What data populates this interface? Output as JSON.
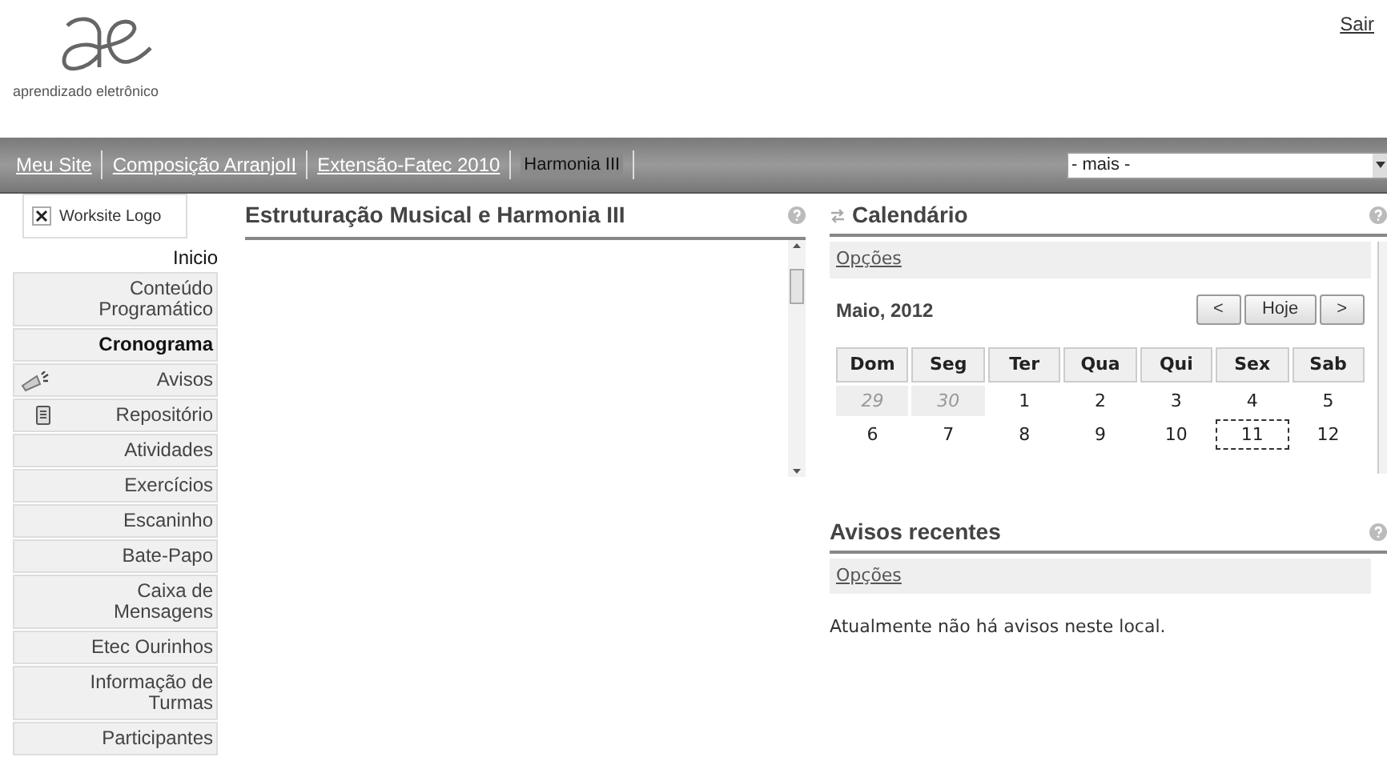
{
  "header": {
    "logo_caption": "aprendizado eletrônico",
    "logout": "Sair"
  },
  "nav": {
    "tabs": [
      {
        "label": "Meu Site",
        "selected": false
      },
      {
        "label": "Composição ArranjoII",
        "selected": false
      },
      {
        "label": "Extensão-Fatec 2010",
        "selected": false
      },
      {
        "label": "Harmonia III",
        "selected": true
      }
    ],
    "more_select": {
      "value": "- mais -"
    }
  },
  "sidebar": {
    "logo_placeholder": "Worksite Logo",
    "items": [
      {
        "label": "Inicio",
        "kind": "heading",
        "selected": false
      },
      {
        "label": "Conteúdo Programático",
        "kind": "plain",
        "selected": false
      },
      {
        "label": "Cronograma",
        "kind": "plain",
        "selected": true
      },
      {
        "label": "Avisos",
        "kind": "announce",
        "selected": false
      },
      {
        "label": "Repositório",
        "kind": "repository",
        "selected": false
      },
      {
        "label": "Atividades",
        "kind": "plain",
        "selected": false
      },
      {
        "label": "Exercícios",
        "kind": "plain",
        "selected": false
      },
      {
        "label": "Escaninho",
        "kind": "plain",
        "selected": false
      },
      {
        "label": "Bate-Papo",
        "kind": "plain",
        "selected": false
      },
      {
        "label": "Caixa de Mensagens",
        "kind": "plain",
        "selected": false
      },
      {
        "label": "Etec Ourinhos",
        "kind": "plain",
        "selected": false
      },
      {
        "label": "Informação de Turmas",
        "kind": "plain",
        "selected": false
      },
      {
        "label": "Participantes",
        "kind": "plain",
        "selected": false
      }
    ]
  },
  "main_panel": {
    "title": "Estruturação Musical e Harmonia III"
  },
  "calendar": {
    "title": "Calendário",
    "options_link": "Opções",
    "month": "Maio, 2012",
    "buttons": [
      "<",
      "Hoje",
      ">"
    ],
    "weekdays": [
      "Dom",
      "Seg",
      "Ter",
      "Qua",
      "Qui",
      "Sex",
      "Sab"
    ],
    "weeks": [
      [
        {
          "day": "29",
          "outside": true,
          "today": false
        },
        {
          "day": "30",
          "outside": true,
          "today": false
        },
        {
          "day": "1",
          "outside": false,
          "today": false
        },
        {
          "day": "2",
          "outside": false,
          "today": false
        },
        {
          "day": "3",
          "outside": false,
          "today": false
        },
        {
          "day": "4",
          "outside": false,
          "today": false
        },
        {
          "day": "5",
          "outside": false,
          "today": false
        }
      ],
      [
        {
          "day": "6",
          "outside": false,
          "today": false
        },
        {
          "day": "7",
          "outside": false,
          "today": false
        },
        {
          "day": "8",
          "outside": false,
          "today": false
        },
        {
          "day": "9",
          "outside": false,
          "today": false
        },
        {
          "day": "10",
          "outside": false,
          "today": false
        },
        {
          "day": "11",
          "outside": false,
          "today": true
        },
        {
          "day": "12",
          "outside": false,
          "today": false
        }
      ]
    ]
  },
  "recent_announcements": {
    "title": "Avisos recentes",
    "options_link": "Opções",
    "empty_message": "Atualmente não há avisos neste local."
  }
}
